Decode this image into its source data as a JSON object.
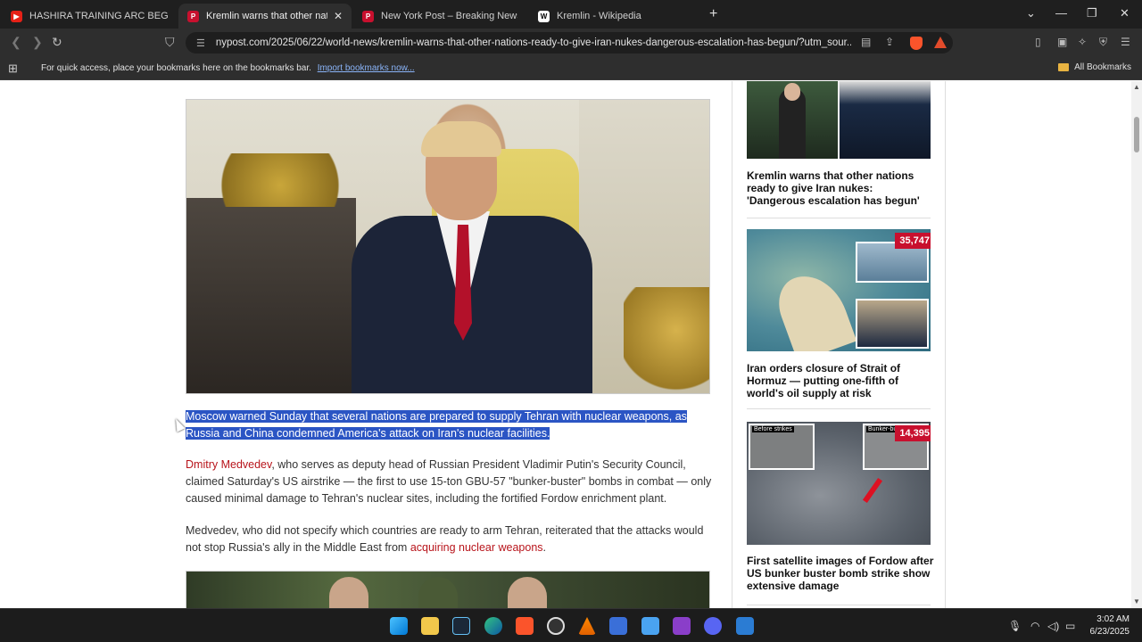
{
  "tabs": [
    {
      "title": "HASHIRA TRAINING ARC BEGINS!! | E",
      "favicon": "youtube-icon"
    },
    {
      "title": "Kremlin warns that other nations",
      "favicon": "nypost-icon",
      "active": true
    },
    {
      "title": "New York Post – Breaking News, Top",
      "favicon": "nypost-icon"
    },
    {
      "title": "Kremlin - Wikipedia",
      "favicon": "wikipedia-icon"
    }
  ],
  "address": {
    "url": "nypost.com/2025/06/22/world-news/kremlin-warns-that-other-nations-ready-to-give-iran-nukes-dangerous-escalation-has-begun/?utm_sour..."
  },
  "bookmarks": {
    "prompt": "For quick access, place your bookmarks here on the bookmarks bar.",
    "import_link": "Import bookmarks now...",
    "all_label": "All Bookmarks"
  },
  "article": {
    "para1": "Moscow warned Sunday that several nations are prepared to supply Tehran with nuclear weapons, as Russia and China condemned America's attack on Iran's nuclear facilities.",
    "para2_link": "Dmitry Medvedev",
    "para2_rest": ", who serves as deputy head of Russian President Vladimir Putin's Security Council, claimed Saturday's US airstrike — the first to use 15-ton GBU-57 \"bunker-buster\" bombs in combat — only caused minimal damage to Tehran's nuclear sites, including the fortified Fordow enrichment plant.",
    "para3_start": "Medvedev, who did not specify which countries are ready to arm Tehran, reiterated that the attacks would not stop Russia's ally in the Middle East from ",
    "para3_link": "acquiring nuclear weapons",
    "para3_end": "."
  },
  "sidebar": [
    {
      "title": "Kremlin warns that other nations ready to give Iran nukes: 'Dangerous escalation has begun'",
      "count": ""
    },
    {
      "title": "Iran orders closure of Strait of Hormuz — putting one-fifth of world's oil supply at risk",
      "count": "35,747"
    },
    {
      "title": "First satellite images of Fordow after US bunker buster bomb strike show extensive damage",
      "count": "14,395",
      "before_label": "Before strikes",
      "after_label": "Bunker-bu"
    }
  ],
  "clock": {
    "time": "3:02 AM",
    "date": "6/23/2025"
  },
  "colors": {
    "highlight": "#2b55c4",
    "link_red": "#b8141b",
    "badge_red": "#c8102e"
  }
}
